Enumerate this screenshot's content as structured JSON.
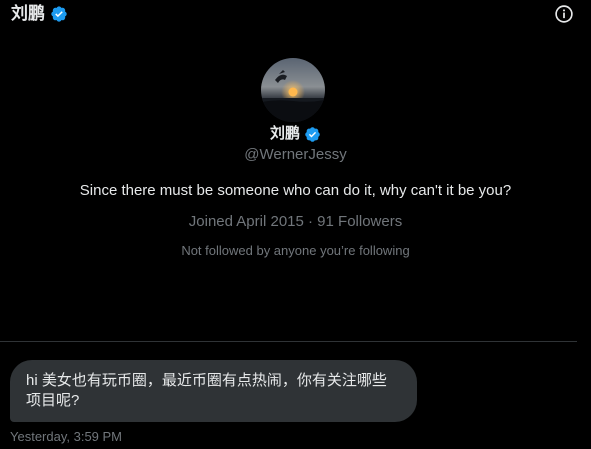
{
  "header": {
    "name": "刘鹏",
    "verified_icon": "verified-badge-icon",
    "info_icon": "info-icon"
  },
  "profile": {
    "name": "刘鹏",
    "handle": "@WernerJessy",
    "bio": "Since there must be someone who can do it, why can't it be you?",
    "meta": "Joined April 2015 · 91 Followers",
    "not_followed": "Not followed by anyone you’re following"
  },
  "messages": [
    {
      "text": "hi  美女也有玩币圈，最近币圈有点热闹，你有关注哪些项目呢?",
      "timestamp": "Yesterday, 3:59 PM"
    }
  ],
  "colors": {
    "background": "#000000",
    "text_primary": "#e7e9ea",
    "text_secondary": "#71767b",
    "verified_blue": "#1d9bf0",
    "bubble": "#2f3336",
    "divider": "#2f3336"
  }
}
